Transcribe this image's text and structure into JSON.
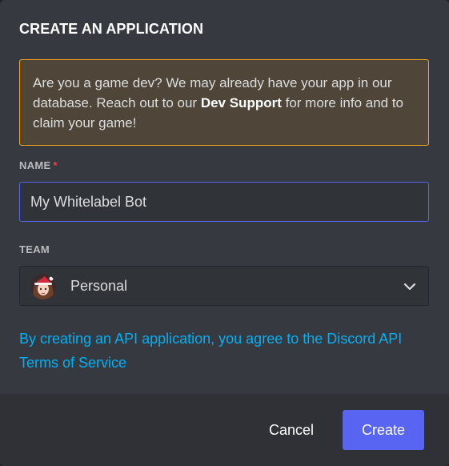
{
  "dialog": {
    "title": "CREATE AN APPLICATION"
  },
  "notice": {
    "text_before": "Are you a game dev? We may already have your app in our database. Reach out to our ",
    "link_text": "Dev Support",
    "text_after": " for more info and to claim your game!",
    "border_color": "#faa61a",
    "background_color": "#4f4639"
  },
  "name_field": {
    "label": "NAME",
    "required_marker": "*",
    "value": "My Whitelabel Bot"
  },
  "team_field": {
    "label": "TEAM",
    "selected": "Personal",
    "avatar_icon": "user-avatar-icon",
    "dropdown_icon": "chevron-down-icon"
  },
  "terms": {
    "text": "By creating an API application, you agree to the Discord API Terms of Service"
  },
  "footer": {
    "cancel_label": "Cancel",
    "create_label": "Create"
  },
  "colors": {
    "accent": "#5865f2",
    "link": "#00b0f4",
    "required": "#ed4245",
    "background": "#36393f",
    "footer": "#2f3136"
  }
}
